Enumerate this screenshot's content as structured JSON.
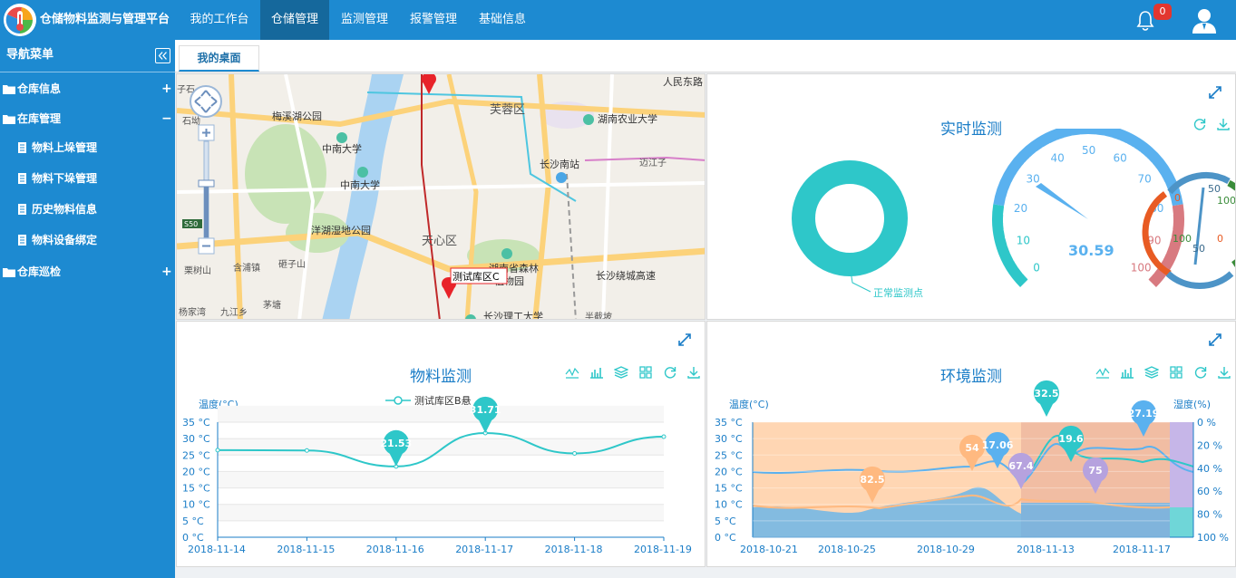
{
  "app": {
    "title": "仓储物料监测与管理平台"
  },
  "topnav": [
    {
      "label": "我的工作台"
    },
    {
      "label": "仓储管理"
    },
    {
      "label": "监测管理"
    },
    {
      "label": "报警管理"
    },
    {
      "label": "基础信息"
    }
  ],
  "header": {
    "bell_count": "0"
  },
  "sidebar": {
    "title": "导航菜单",
    "groups": [
      {
        "label": "仓库信息",
        "toggle": "+"
      },
      {
        "label": "在库管理",
        "toggle": "−"
      },
      {
        "label": "仓库巡检",
        "toggle": "+"
      }
    ],
    "items": [
      {
        "label": "物料上垛管理"
      },
      {
        "label": "物料下垛管理"
      },
      {
        "label": "历史物料信息"
      },
      {
        "label": "物料设备绑定"
      }
    ]
  },
  "tabs": [
    {
      "label": "我的桌面"
    }
  ],
  "map": {
    "labels": [
      "人民东路",
      "芙蓉区",
      "湖南农业大学",
      "梅溪湖公园",
      "中南大学",
      "长沙南站",
      "中南大学",
      "洋湖湿地公园",
      "天心区",
      "长沙绕城高速",
      "栗树山",
      "含浦镇",
      "砸子山",
      "杨家湾",
      "九江乡",
      "茅塘",
      "迈江子",
      "长沙理工大学",
      "半截坡",
      "植物园",
      "湖南省森林",
      "子石",
      "石坳",
      "S50"
    ],
    "marker_label": "测试库区C"
  },
  "realtime": {
    "title": "实时监测",
    "legend": "正常监测点",
    "gauge_value": "30.59",
    "gauge_ticks": [
      "0",
      "10",
      "20",
      "30",
      "40",
      "50",
      "60",
      "70",
      "80",
      "90",
      "100"
    ],
    "small_gauge_ticks": [
      "0",
      "50",
      "100",
      "100",
      "50",
      "0"
    ]
  },
  "material": {
    "title": "物料监测",
    "y_label": "温度(°C)",
    "legend": "测试库区B悬"
  },
  "environment": {
    "title": "环境监测",
    "y_left_label": "温度(°C)",
    "y_right_label": "湿度(%)"
  },
  "chart_data": [
    {
      "type": "line",
      "title": "物料监测",
      "ylabel": "温度(°C)",
      "x": [
        "2018-11-14",
        "2018-11-15",
        "2018-11-16",
        "2018-11-17",
        "2018-11-18",
        "2018-11-19"
      ],
      "series": [
        {
          "name": "测试库区B悬",
          "values": [
            26.5,
            26.4,
            21.53,
            31.71,
            25.5,
            30.6
          ]
        }
      ],
      "ylim": [
        0,
        35
      ],
      "yticks": [
        "0 °C",
        "5 °C",
        "10 °C",
        "15 °C",
        "20 °C",
        "25 °C",
        "30 °C",
        "35 °C"
      ],
      "markers": [
        {
          "label": "21.53",
          "x": "2018-11-16",
          "y": 21.53
        },
        {
          "label": "31.71",
          "x": "2018-11-17",
          "y": 31.71
        }
      ],
      "color": "#2ec7c9",
      "grid": true
    },
    {
      "type": "line",
      "title": "环境监测",
      "ylabel": "温度(°C)",
      "y2label": "湿度(%)",
      "x": [
        "2018-10-21",
        "2018-10-25",
        "2018-10-29",
        "2018-11-13",
        "2018-11-17"
      ],
      "xticks": [
        "2018-10-21",
        "2018-10-25",
        "2018-10-29",
        "2018-11-13",
        "2018-11-17"
      ],
      "ylim": [
        0,
        35
      ],
      "y2lim": [
        0,
        100
      ],
      "yticks": [
        "0 °C",
        "5 °C",
        "10 °C",
        "15 °C",
        "20 °C",
        "25 °C",
        "30 °C",
        "35 °C"
      ],
      "y2ticks": [
        "0 %",
        "20 %",
        "40 %",
        "60 %",
        "80 %",
        "100 %"
      ],
      "markers": [
        {
          "label": "82.5",
          "color": "#ffb980"
        },
        {
          "label": "54",
          "color": "#ffb980"
        },
        {
          "label": "17.06",
          "color": "#5ab1ef"
        },
        {
          "label": "67.4",
          "color": "#b6a2de"
        },
        {
          "label": "32.5",
          "color": "#2ec7c9"
        },
        {
          "label": "19.6",
          "color": "#2ec7c9"
        },
        {
          "label": "75",
          "color": "#b6a2de"
        },
        {
          "label": "27.19",
          "color": "#5ab1ef"
        }
      ],
      "grid": true
    }
  ]
}
